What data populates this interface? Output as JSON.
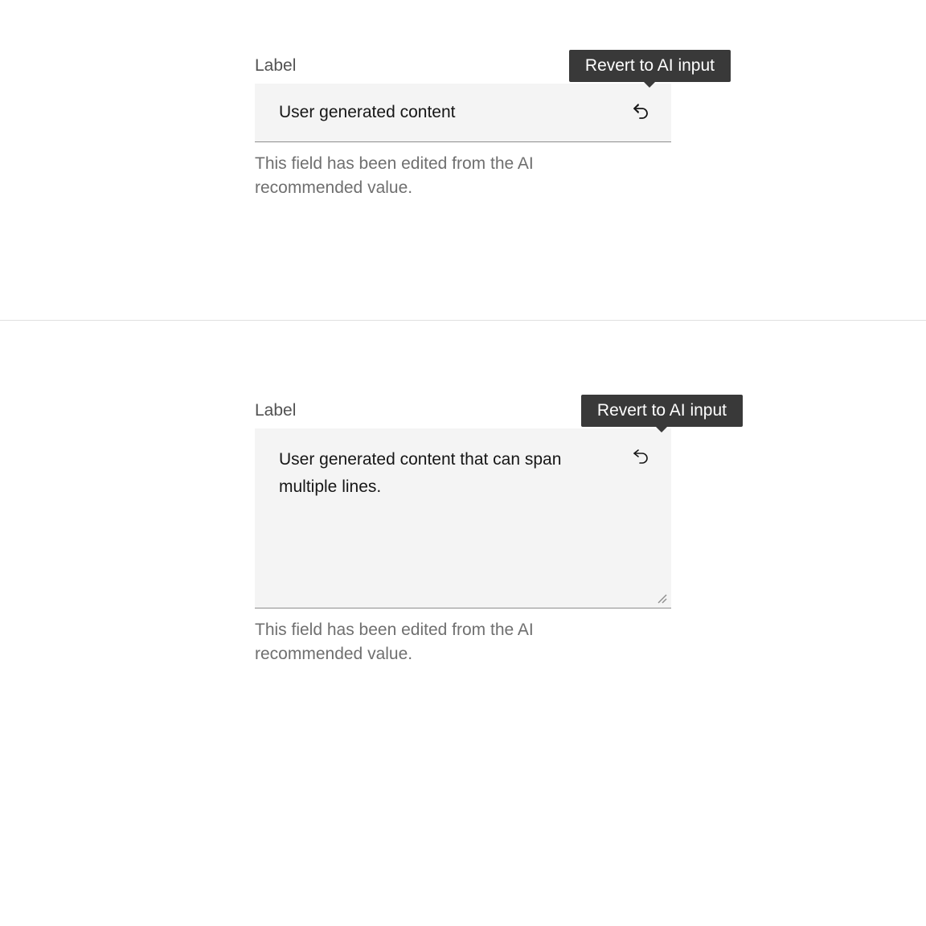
{
  "input_example": {
    "label": "Label",
    "value": "User generated content",
    "tooltip": "Revert to AI input",
    "helper": "This field has been edited from the AI recommended value."
  },
  "textarea_example": {
    "label": "Label",
    "value": "User generated content that can span multiple lines.",
    "tooltip": "Revert to AI input",
    "helper": "This field has been edited from the AI recommended value."
  }
}
